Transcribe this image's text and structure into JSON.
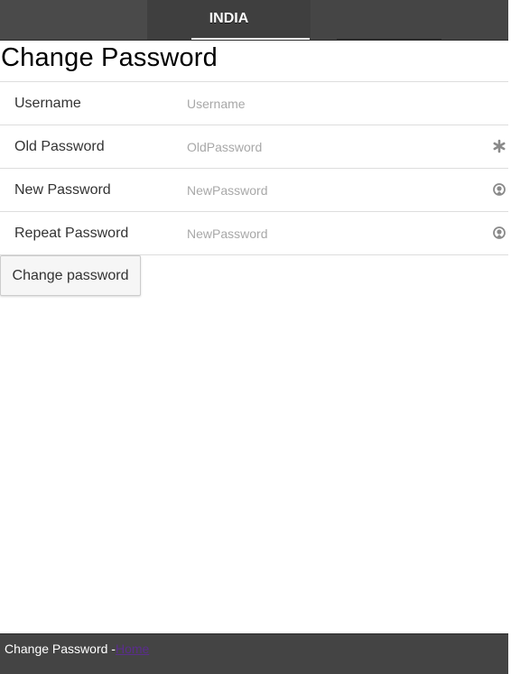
{
  "header": {
    "title": "INDIA"
  },
  "page": {
    "title": "Change Password"
  },
  "form": {
    "fields": [
      {
        "label": "Username",
        "placeholder": "Username",
        "value": "",
        "icon": ""
      },
      {
        "label": "Old Password",
        "placeholder": "OldPassword",
        "value": "",
        "icon": "asterisk-icon"
      },
      {
        "label": "New Password",
        "placeholder": "NewPassword",
        "value": "",
        "icon": "refresh-icon"
      },
      {
        "label": "Repeat Password",
        "placeholder": "NewPassword",
        "value": "",
        "icon": "refresh-icon"
      }
    ],
    "submit_label": "Change password"
  },
  "footer": {
    "text": "Change Password -",
    "link_label": "Home"
  },
  "colors": {
    "bar_background": "#444444",
    "link": "#5a2d8c"
  }
}
